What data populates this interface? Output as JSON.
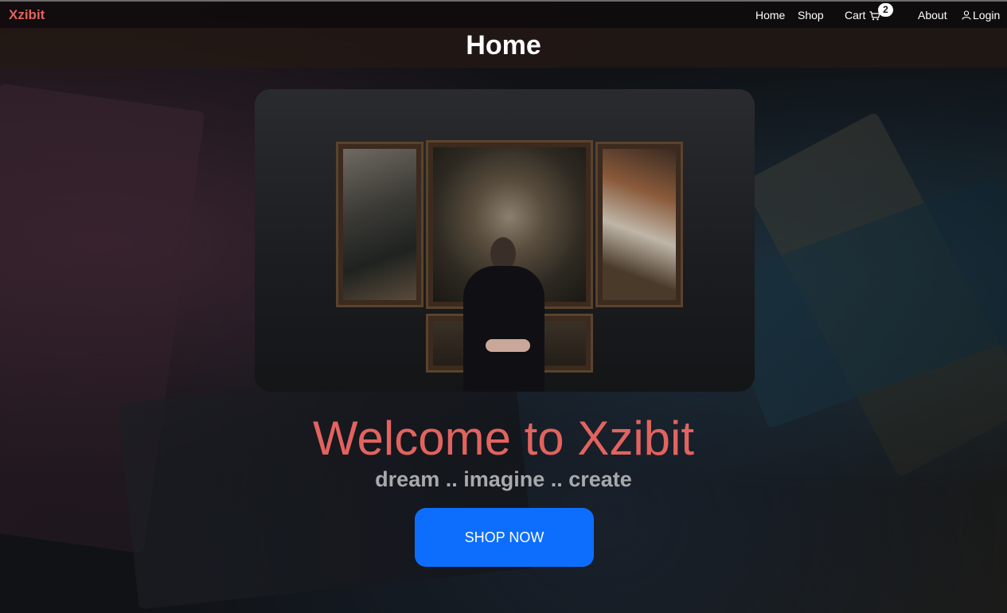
{
  "navbar": {
    "brand": "Xzibit",
    "links": {
      "home": "Home",
      "shop": "Shop",
      "cart": "Cart",
      "about": "About",
      "login": "Login"
    },
    "cart_count": "2",
    "cart_icon": "cart-icon",
    "login_icon": "user-icon"
  },
  "header": {
    "title": "Home"
  },
  "hero": {
    "image_subject": "person viewing triptych painting in gallery",
    "heading": "Welcome to Xzibit",
    "tagline": "dream .. imagine .. create",
    "cta_label": "SHOP NOW"
  },
  "colors": {
    "brand": "#e2635f",
    "primary_button": "#0d6efd",
    "tagline": "#a7a9ac"
  }
}
